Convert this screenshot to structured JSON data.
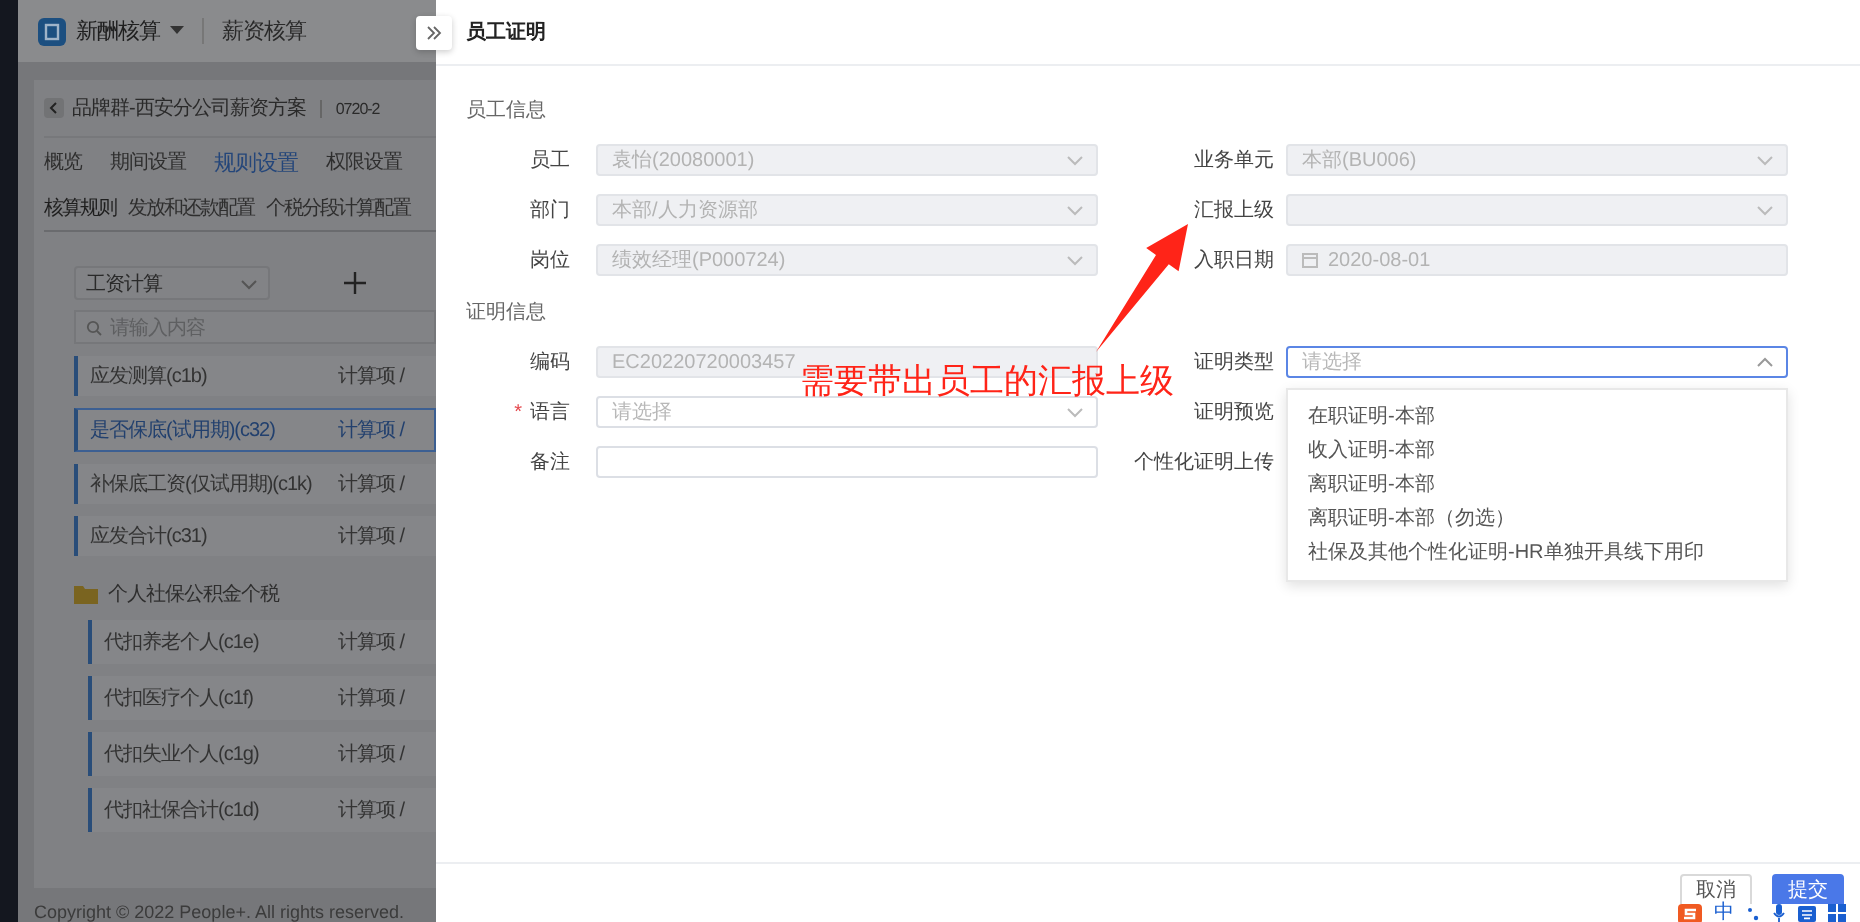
{
  "app_header": {
    "module": "新酬核算",
    "title": "薪资核算"
  },
  "scheme": {
    "title": "品牌群-西安分公司薪资方案",
    "version": "0720-2"
  },
  "tabs": [
    {
      "label": "概览",
      "selected": false
    },
    {
      "label": "期间设置",
      "selected": false
    },
    {
      "label": "规则设置",
      "selected": true
    },
    {
      "label": "权限设置",
      "selected": false
    }
  ],
  "subtabs": [
    {
      "label": "核算规则",
      "selected": true
    },
    {
      "label": "发放和还款配置",
      "selected": false
    },
    {
      "label": "个税分段计算配置",
      "selected": false
    }
  ],
  "rule_group_select": {
    "value": "工资计算"
  },
  "search": {
    "placeholder": "请输入内容"
  },
  "rules": [
    {
      "name": "应发测算(c1b)",
      "type": "计算项 /",
      "selected": false
    },
    {
      "name": "是否保底(试用期)(c32)",
      "type": "计算项 /",
      "selected": true
    },
    {
      "name": "补保底工资(仅试用期)(c1k)",
      "type": "计算项 /",
      "selected": false
    },
    {
      "name": "应发合计(c31)",
      "type": "计算项 /",
      "selected": false
    }
  ],
  "folder": {
    "name": "个人社保公积金个税",
    "children": [
      {
        "name": "代扣养老个人(c1e)",
        "type": "计算项 /"
      },
      {
        "name": "代扣医疗个人(c1f)",
        "type": "计算项 /"
      },
      {
        "name": "代扣失业个人(c1g)",
        "type": "计算项 /"
      },
      {
        "name": "代扣社保合计(c1d)",
        "type": "计算项 /"
      }
    ]
  },
  "copyright": "Copyright © 2022 People+. All rights reserved.",
  "drawer": {
    "title": "员工证明",
    "required_mark": "*",
    "sections": [
      {
        "title": "员工信息",
        "fields": [
          {
            "label": "员工",
            "kind": "select",
            "value": "袁怡(20080001)",
            "disabled": true,
            "required": false
          },
          {
            "label": "业务单元",
            "kind": "select",
            "value": "本部(BU006)",
            "disabled": true,
            "required": false
          },
          {
            "label": "部门",
            "kind": "select",
            "value": "本部/人力资源部",
            "disabled": true,
            "required": false
          },
          {
            "label": "汇报上级",
            "kind": "select",
            "disabled": true,
            "required": false
          },
          {
            "label": "岗位",
            "kind": "select",
            "value": "绩效经理(P000724)",
            "disabled": true,
            "required": false
          },
          {
            "label": "入职日期",
            "kind": "date",
            "value": "2020-08-01",
            "disabled": true,
            "required": false
          }
        ]
      },
      {
        "title": "证明信息",
        "fields": [
          {
            "label": "编码",
            "kind": "text",
            "value": "EC20220720003457",
            "disabled": true,
            "required": false
          },
          {
            "label": "证明类型",
            "kind": "select",
            "placeholder": "请选择",
            "disabled": false,
            "required": false,
            "open": true,
            "options": [
              "在职证明-本部",
              "收入证明-本部",
              "离职证明-本部",
              "离职证明-本部（勿选）",
              "社保及其他个性化证明-HR单独开具线下用印"
            ]
          },
          {
            "label": "语言",
            "kind": "select",
            "placeholder": "请选择",
            "disabled": false,
            "required": true,
            "open": false
          },
          {
            "label": "证明预览",
            "kind": "label_only",
            "required": false
          },
          {
            "label": "备注",
            "kind": "text",
            "disabled": false,
            "required": false
          },
          {
            "label": "个性化证明上传",
            "kind": "label_only",
            "required": false
          }
        ]
      }
    ]
  },
  "buttons": [
    {
      "label": "取消",
      "kind": "default"
    },
    {
      "label": "提交",
      "kind": "primary"
    }
  ],
  "annotation": {
    "text": "需要带出员工的汇报上级"
  },
  "ime_bar": {
    "mode": "中"
  }
}
